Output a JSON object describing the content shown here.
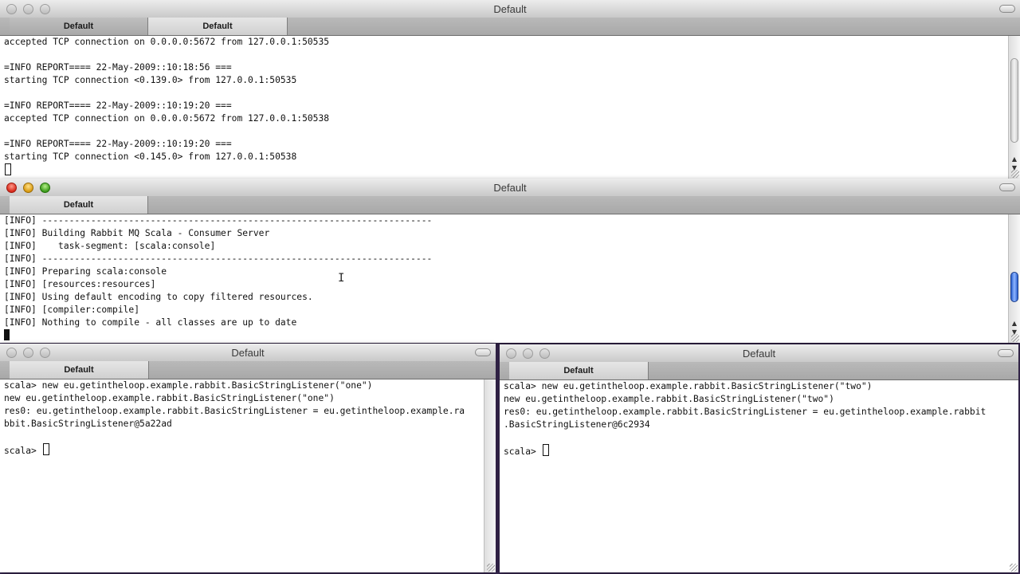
{
  "window1": {
    "title": "Default",
    "tabs": [
      "Default",
      "Default"
    ],
    "lines": [
      "accepted TCP connection on 0.0.0.0:5672 from 127.0.0.1:50535",
      "",
      "=INFO REPORT==== 22-May-2009::10:18:56 ===",
      "starting TCP connection <0.139.0> from 127.0.0.1:50535",
      "",
      "=INFO REPORT==== 22-May-2009::10:19:20 ===",
      "accepted TCP connection on 0.0.0.0:5672 from 127.0.0.1:50538",
      "",
      "=INFO REPORT==== 22-May-2009::10:19:20 ===",
      "starting TCP connection <0.145.0> from 127.0.0.1:50538"
    ]
  },
  "window2": {
    "title": "Default",
    "tab": "Default",
    "lines": [
      "[INFO] ------------------------------------------------------------------------",
      "[INFO] Building Rabbit MQ Scala - Consumer Server",
      "[INFO]    task-segment: [scala:console]",
      "[INFO] ------------------------------------------------------------------------",
      "[INFO] Preparing scala:console",
      "[INFO] [resources:resources]",
      "[INFO] Using default encoding to copy filtered resources.",
      "[INFO] [compiler:compile]",
      "[INFO] Nothing to compile - all classes are up to date"
    ]
  },
  "window3": {
    "title": "Default",
    "tab": "Default",
    "lines": [
      "scala> new eu.getintheloop.example.rabbit.BasicStringListener(\"one\")",
      "new eu.getintheloop.example.rabbit.BasicStringListener(\"one\")",
      "res0: eu.getintheloop.example.rabbit.BasicStringListener = eu.getintheloop.example.ra",
      "bbit.BasicStringListener@5a22ad",
      ""
    ],
    "prompt": "scala> "
  },
  "window4": {
    "title": "Default",
    "tab": "Default",
    "lines": [
      "scala> new eu.getintheloop.example.rabbit.BasicStringListener(\"two\")",
      "new eu.getintheloop.example.rabbit.BasicStringListener(\"two\")",
      "res0: eu.getintheloop.example.rabbit.BasicStringListener = eu.getintheloop.example.rabbit",
      ".BasicStringListener@6c2934",
      ""
    ],
    "prompt": "scala> "
  },
  "icons": [
    "close-icon",
    "minimize-icon",
    "zoom-icon",
    "toolbar-toggle-icon",
    "resize-grip-icon",
    "scroll-up-icon",
    "scroll-down-icon",
    "text-cursor-icon"
  ]
}
